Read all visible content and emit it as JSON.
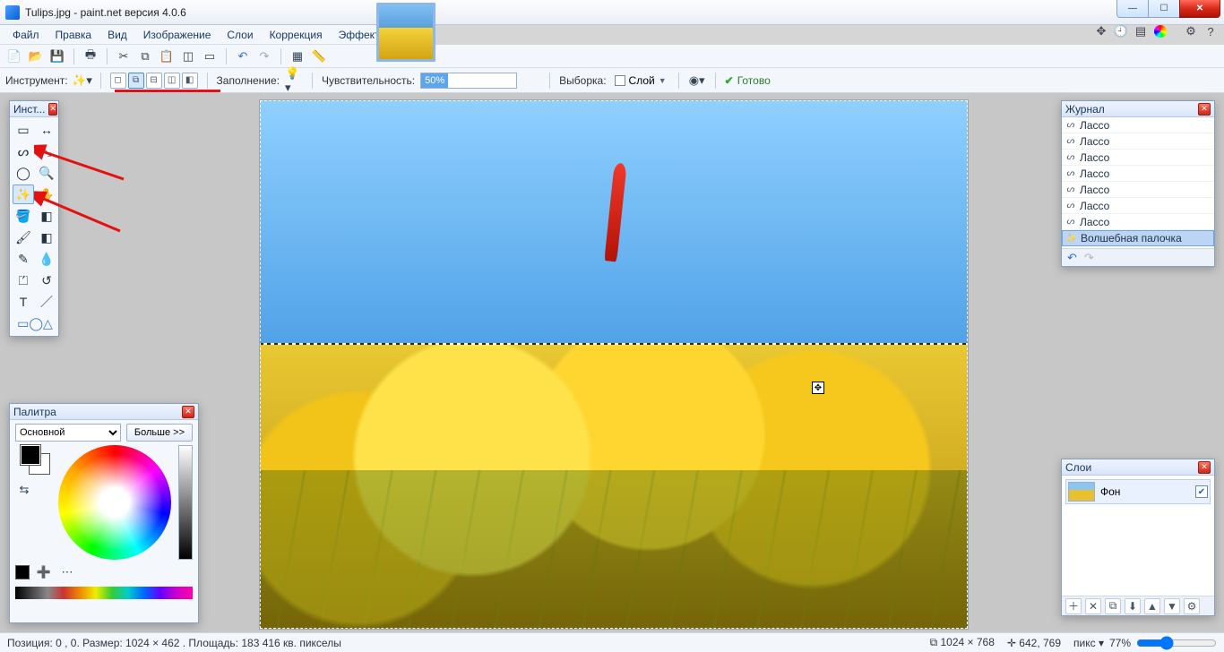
{
  "title": "Tulips.jpg - paint.net версия 4.0.6",
  "menus": [
    "Файл",
    "Правка",
    "Вид",
    "Изображение",
    "Слои",
    "Коррекция",
    "Эффекты"
  ],
  "optionbar": {
    "tool_label": "Инструмент:",
    "fill_label": "Заполнение:",
    "tolerance_label": "Чувствительность:",
    "tolerance_value": "50%",
    "sampling_label": "Выборка:",
    "sampling_value": "Слой",
    "ready": "Готово"
  },
  "panels": {
    "tools_title": "Инст...",
    "history_title": "Журнал",
    "layers_title": "Слои",
    "colors_title": "Палитра"
  },
  "colors": {
    "primary_label": "Основной",
    "more_label": "Больше >>"
  },
  "history": {
    "items": [
      "Лассо",
      "Лассо",
      "Лассо",
      "Лассо",
      "Лассо",
      "Лассо",
      "Лассо"
    ],
    "current": "Волшебная палочка"
  },
  "layers": {
    "items": [
      {
        "name": "Фон",
        "visible": true
      }
    ]
  },
  "status": {
    "selection": "Позиция: 0 , 0. Размер:  1024  × 462 . Площадь: 183 416 кв. пикселы",
    "doc_size": "1024 × 768",
    "cursor": "642, 769",
    "units": "пикс",
    "zoom": "77%"
  }
}
